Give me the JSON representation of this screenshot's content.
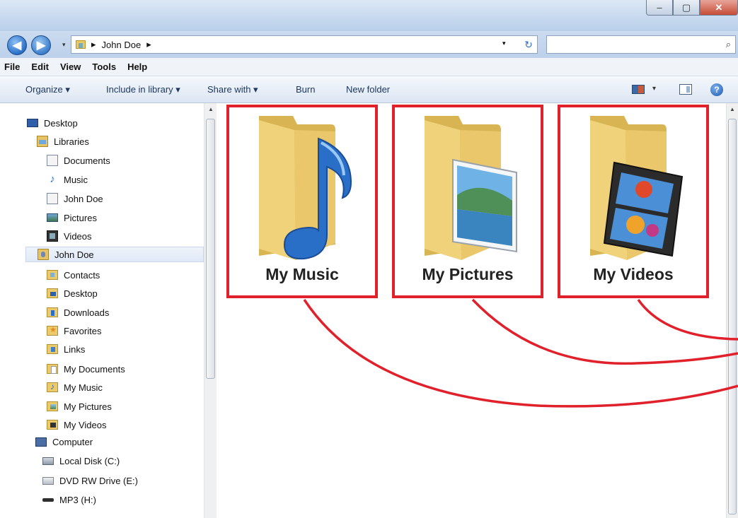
{
  "window": {
    "minimize_glyph": "–",
    "maximize_glyph": "▢",
    "close_glyph": "✕"
  },
  "address": {
    "path_separator": "▸",
    "current": "John Doe",
    "trailing_separator": "▸",
    "back_glyph": "◀",
    "forward_glyph": "▶",
    "refresh_glyph": "↻",
    "search_placeholder": "",
    "search_glyph": "⌕"
  },
  "menu": {
    "items": [
      "File",
      "Edit",
      "View",
      "Tools",
      "Help"
    ]
  },
  "toolbar": {
    "organize": "Organize ▾",
    "include_in_library": "Include in library ▾",
    "share_with": "Share with ▾",
    "burn": "Burn",
    "new_folder": "New folder",
    "view_dropdown": "▾",
    "help_glyph": "?"
  },
  "nav": {
    "items": [
      {
        "label": "Desktop",
        "icon": "desktop-icon"
      },
      {
        "label": "Libraries",
        "icon": "libraries-icon"
      },
      {
        "label": "Documents",
        "icon": "documents-icon"
      },
      {
        "label": "Music",
        "icon": "music-icon"
      },
      {
        "label": "John Doe",
        "icon": "user-folder-icon"
      },
      {
        "label": "Pictures",
        "icon": "pictures-icon"
      },
      {
        "label": "Videos",
        "icon": "videos-icon"
      },
      {
        "label": "John Doe",
        "icon": "user-folder-icon"
      },
      {
        "label": "Contacts",
        "icon": "contacts-folder-icon"
      },
      {
        "label": "Desktop",
        "icon": "desktop-folder-icon"
      },
      {
        "label": "Downloads",
        "icon": "downloads-folder-icon"
      },
      {
        "label": "Favorites",
        "icon": "favorites-folder-icon"
      },
      {
        "label": "Links",
        "icon": "links-folder-icon"
      },
      {
        "label": "My Documents",
        "icon": "my-documents-folder-icon"
      },
      {
        "label": "My Music",
        "icon": "my-music-folder-icon"
      },
      {
        "label": "My Pictures",
        "icon": "my-pictures-folder-icon"
      },
      {
        "label": "My Videos",
        "icon": "my-videos-folder-icon"
      },
      {
        "label": "Computer",
        "icon": "computer-icon"
      },
      {
        "label": "Local Disk (C:)",
        "icon": "local-disk-icon"
      },
      {
        "label": "DVD RW Drive (E:)",
        "icon": "dvd-drive-icon"
      },
      {
        "label": "MP3 (H:)",
        "icon": "mp3-drive-icon"
      }
    ],
    "selected_index": 7
  },
  "content": {
    "folders": [
      {
        "label": "My Music",
        "overlay": "music-note"
      },
      {
        "label": "My Pictures",
        "overlay": "landscape-photo"
      },
      {
        "label": "My Videos",
        "overlay": "film-strip"
      }
    ],
    "highlight_color": "#e0212b"
  },
  "colors": {
    "folder": "#f0d27a",
    "folder_dark": "#d8b552",
    "accent": "#2a6fc7"
  }
}
